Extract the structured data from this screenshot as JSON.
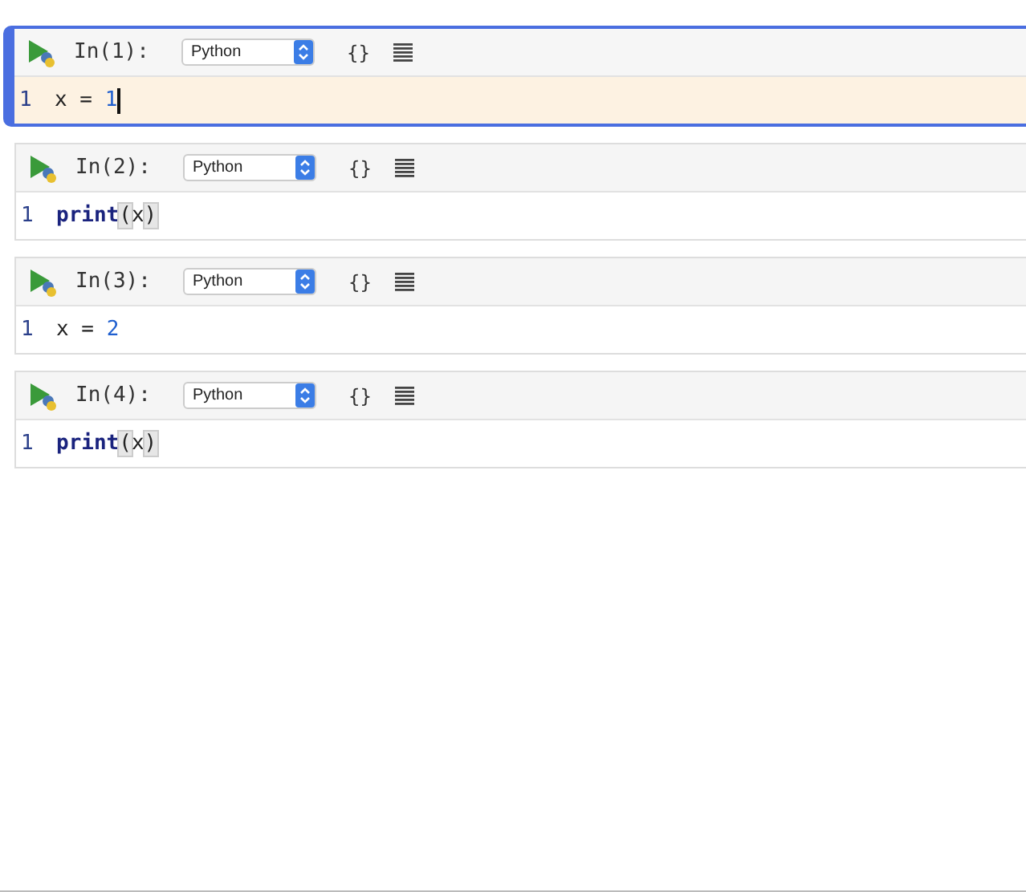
{
  "cells": [
    {
      "prompt": "In(1):",
      "language": "Python",
      "selected": true,
      "lines": [
        {
          "number": "1",
          "tokens": [
            {
              "text": "x = ",
              "kind": "plain"
            },
            {
              "text": "1",
              "kind": "number"
            }
          ]
        }
      ]
    },
    {
      "prompt": "In(2):",
      "language": "Python",
      "selected": false,
      "lines": [
        {
          "number": "1",
          "tokens": [
            {
              "text": "print",
              "kind": "keyword"
            },
            {
              "text": "(",
              "kind": "bracket-match"
            },
            {
              "text": "x",
              "kind": "plain"
            },
            {
              "text": ")",
              "kind": "bracket-match"
            }
          ]
        }
      ]
    },
    {
      "prompt": "In(3):",
      "language": "Python",
      "selected": false,
      "lines": [
        {
          "number": "1",
          "tokens": [
            {
              "text": "x = ",
              "kind": "plain"
            },
            {
              "text": "2",
              "kind": "number"
            }
          ]
        }
      ]
    },
    {
      "prompt": "In(4):",
      "language": "Python",
      "selected": false,
      "lines": [
        {
          "number": "1",
          "tokens": [
            {
              "text": "print",
              "kind": "keyword"
            },
            {
              "text": "(",
              "kind": "bracket-match"
            },
            {
              "text": "x",
              "kind": "plain"
            },
            {
              "text": ")",
              "kind": "bracket-match"
            }
          ]
        }
      ]
    }
  ],
  "toolbar": {
    "braces": "{}"
  }
}
